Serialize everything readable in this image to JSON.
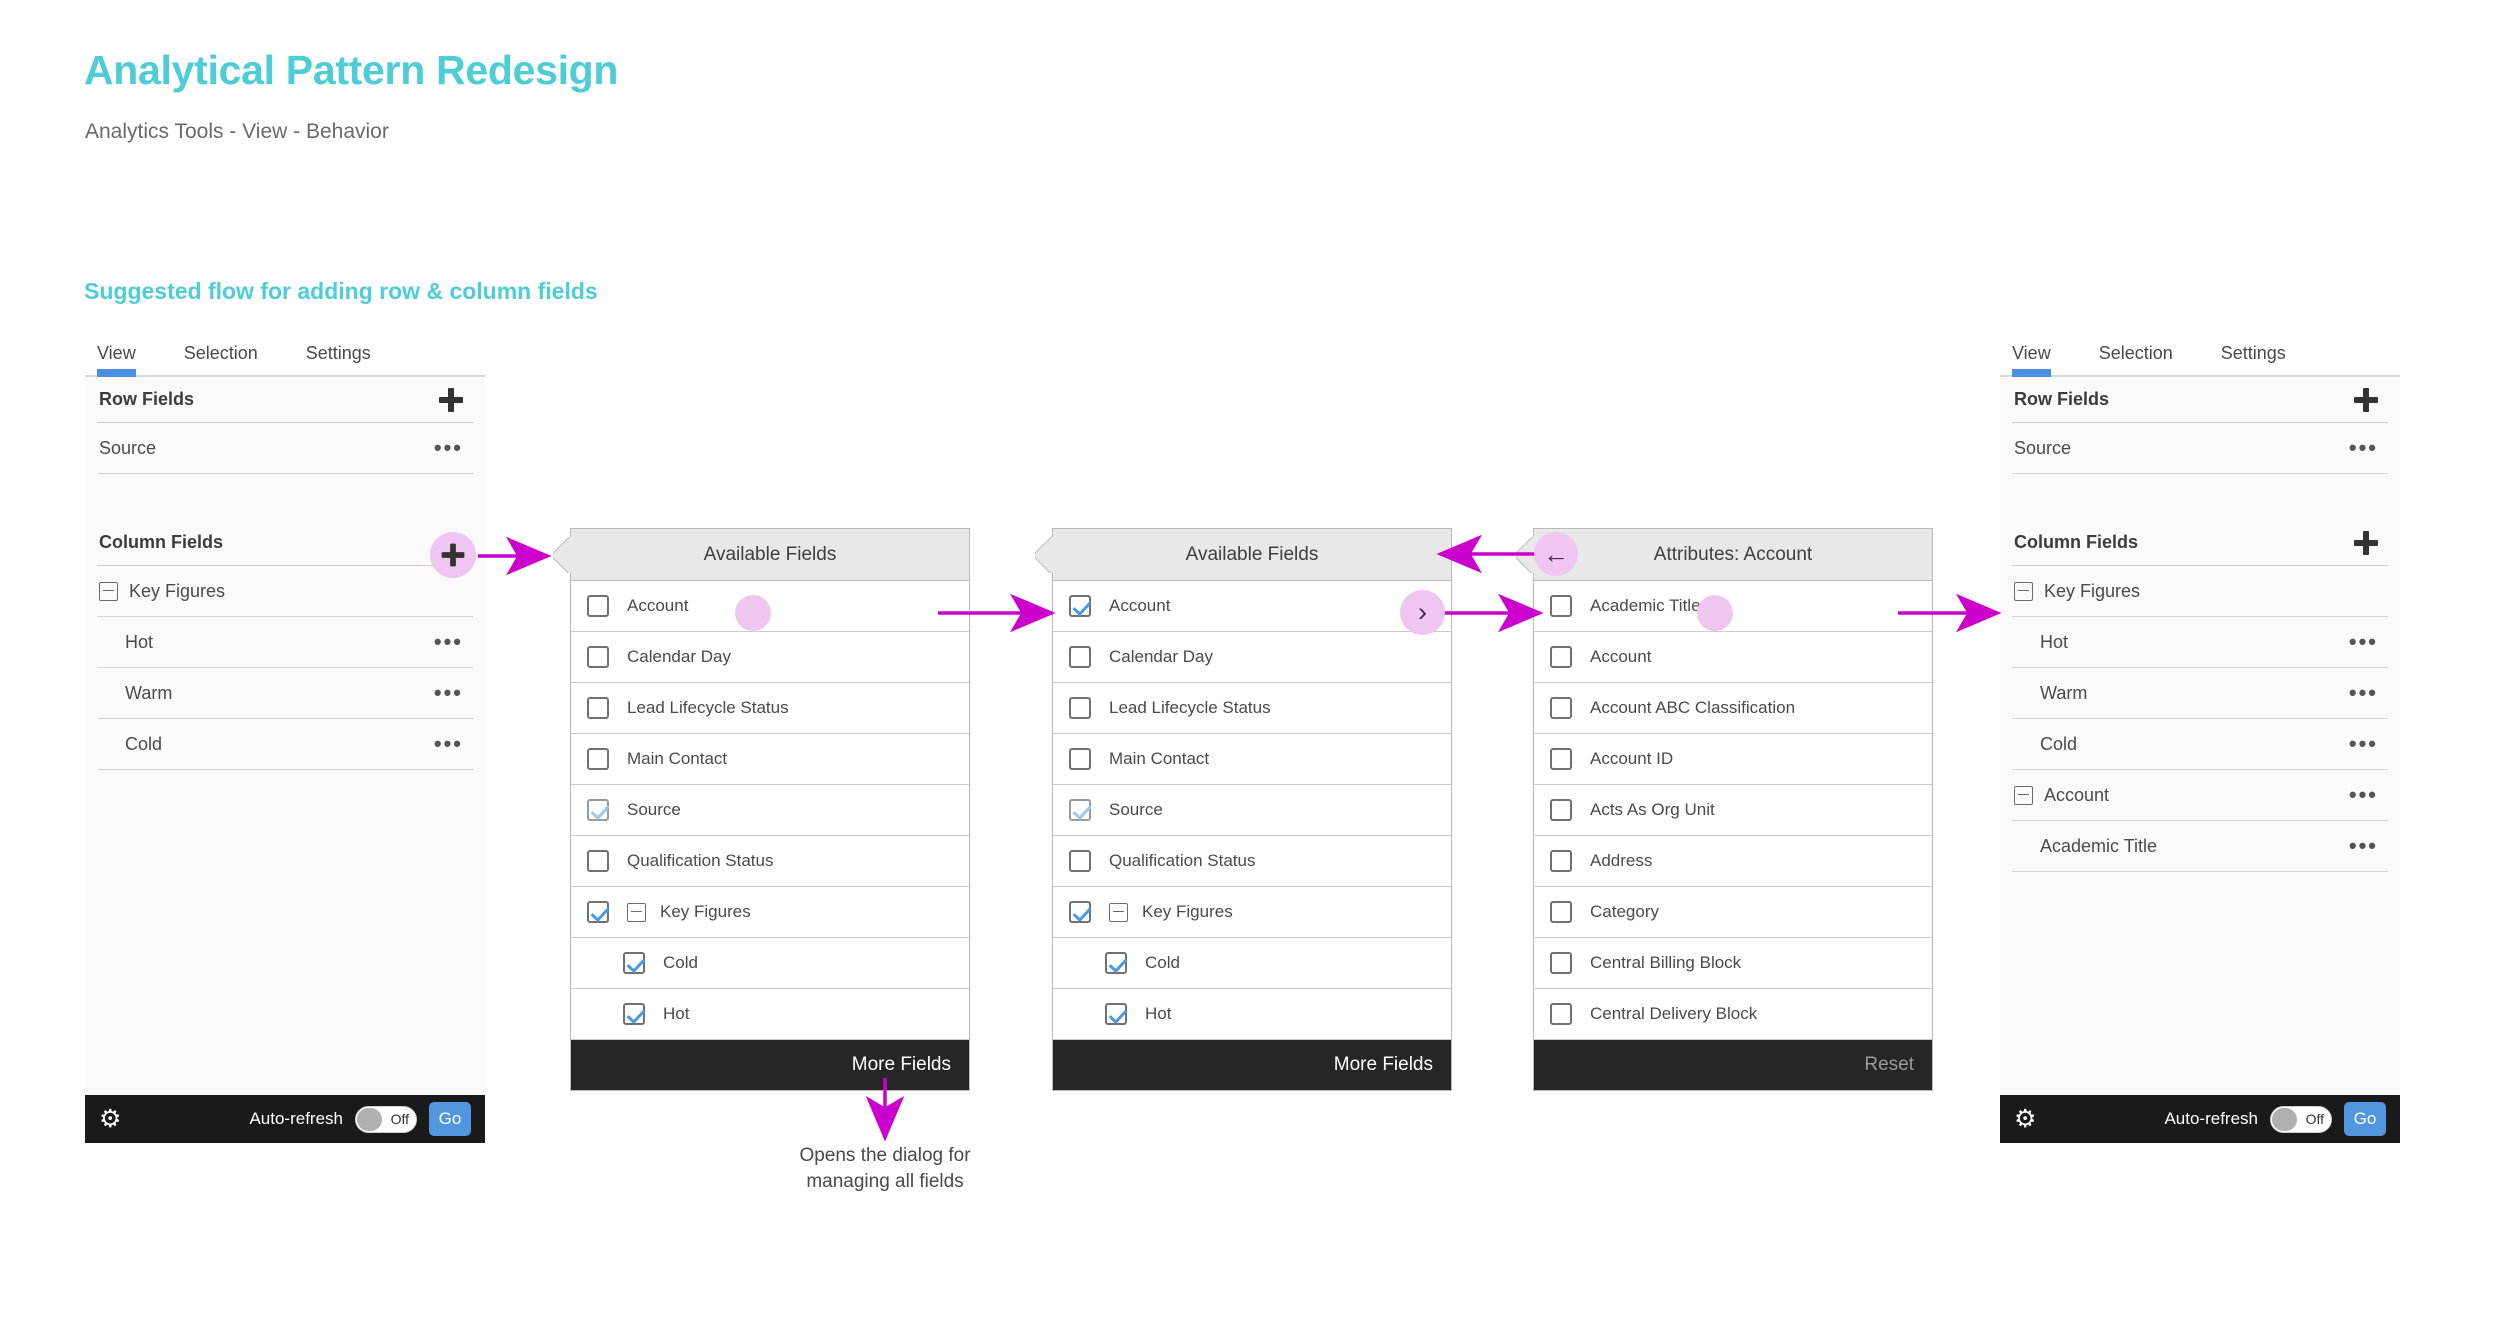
{
  "header": {
    "title": "Analytical Pattern Redesign",
    "subtitle": "Analytics Tools - View - Behavior",
    "title_color": "#4ecdd6"
  },
  "section": {
    "title": "Suggested flow for adding row & column fields"
  },
  "tabs": [
    "View",
    "Selection",
    "Settings"
  ],
  "panel_left": {
    "row_fields": {
      "label": "Row Fields",
      "add_icon": "plus-icon",
      "items": [
        {
          "label": "Source",
          "menu_icon": "more-icon"
        }
      ]
    },
    "column_fields": {
      "label": "Column Fields",
      "add_icon": "plus-icon",
      "items": [
        {
          "label": "Key Figures",
          "tree": true,
          "menu": false
        },
        {
          "label": "Hot",
          "indent": true,
          "menu": true
        },
        {
          "label": "Warm",
          "indent": true,
          "menu": true
        },
        {
          "label": "Cold",
          "indent": true,
          "menu": true
        }
      ]
    },
    "footer": {
      "gear_icon": "gear-icon",
      "auto_refresh_label": "Auto-refresh",
      "toggle_state": "Off",
      "go_label": "Go",
      "go_color": "#5296e0"
    }
  },
  "panel_right": {
    "row_fields": {
      "label": "Row Fields",
      "add_icon": "plus-icon",
      "items": [
        {
          "label": "Source",
          "menu_icon": "more-icon"
        }
      ]
    },
    "column_fields": {
      "label": "Column Fields",
      "add_icon": "plus-icon",
      "items": [
        {
          "label": "Key Figures",
          "tree": true,
          "menu": false
        },
        {
          "label": "Hot",
          "indent": true,
          "menu": true
        },
        {
          "label": "Warm",
          "indent": true,
          "menu": true
        },
        {
          "label": "Cold",
          "indent": true,
          "menu": true
        },
        {
          "label": "Account",
          "tree": true,
          "menu": true
        },
        {
          "label": "Academic Title",
          "indent": true,
          "menu": true
        }
      ]
    },
    "footer": {
      "gear_icon": "gear-icon",
      "auto_refresh_label": "Auto-refresh",
      "toggle_state": "Off",
      "go_label": "Go",
      "go_color": "#5296e0"
    }
  },
  "dialog_1": {
    "title": "Available Fields",
    "rows": [
      {
        "label": "Account",
        "checked": false
      },
      {
        "label": "Calendar Day",
        "checked": false
      },
      {
        "label": "Lead Lifecycle Status",
        "checked": false
      },
      {
        "label": "Main Contact",
        "checked": false
      },
      {
        "label": "Source",
        "checked": true,
        "pale": true
      },
      {
        "label": "Qualification Status",
        "checked": false
      },
      {
        "label": "Key Figures",
        "checked": true,
        "tree": true
      },
      {
        "label": "Cold",
        "checked": true,
        "level": 1
      },
      {
        "label": "Hot",
        "checked": true,
        "level": 1
      }
    ],
    "footer_label": "More Fields"
  },
  "dialog_2": {
    "title": "Available Fields",
    "rows": [
      {
        "label": "Account",
        "checked": true
      },
      {
        "label": "Calendar Day",
        "checked": false
      },
      {
        "label": "Lead Lifecycle Status",
        "checked": false
      },
      {
        "label": "Main Contact",
        "checked": false
      },
      {
        "label": "Source",
        "checked": true,
        "pale": true
      },
      {
        "label": "Qualification Status",
        "checked": false
      },
      {
        "label": "Key Figures",
        "checked": true,
        "tree": true
      },
      {
        "label": "Cold",
        "checked": true,
        "level": 1
      },
      {
        "label": "Hot",
        "checked": true,
        "level": 1
      }
    ],
    "footer_label": "More Fields",
    "drill_icon": "chevron-right-icon"
  },
  "dialog_3": {
    "title": "Attributes: Account",
    "back_icon": "arrow-left-icon",
    "rows": [
      {
        "label": "Academic Title",
        "checked": false
      },
      {
        "label": "Account",
        "checked": false
      },
      {
        "label": "Account ABC Classification",
        "checked": false
      },
      {
        "label": "Account ID",
        "checked": false
      },
      {
        "label": "Acts As Org Unit",
        "checked": false
      },
      {
        "label": "Address",
        "checked": false
      },
      {
        "label": "Category",
        "checked": false
      },
      {
        "label": "Central Billing Block",
        "checked": false
      },
      {
        "label": "Central Delivery Block",
        "checked": false
      }
    ],
    "footer_label": "Reset"
  },
  "annotation": {
    "text": "Opens the dialog for\nmanaging all fields"
  },
  "accent": {
    "magenta": "#cc00cc",
    "highlight": "#eec6f0"
  }
}
